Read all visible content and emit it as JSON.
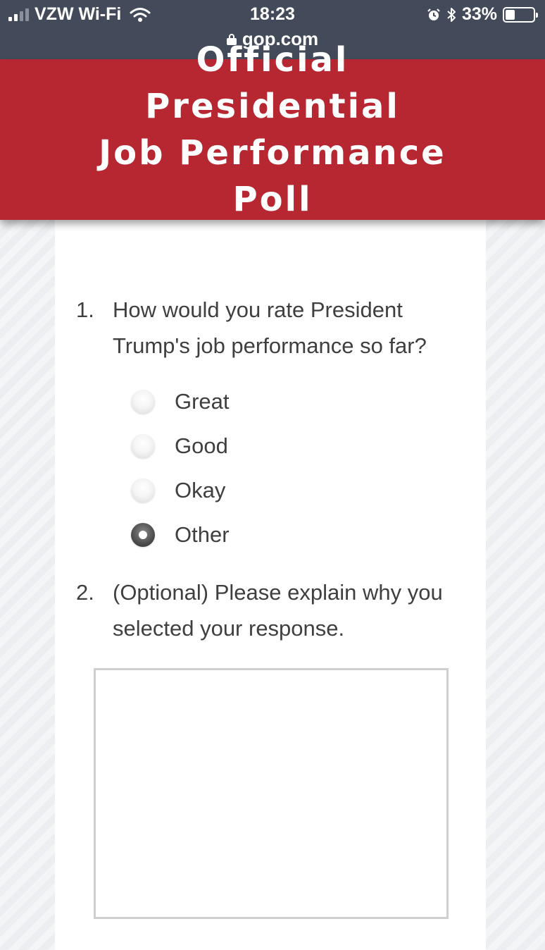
{
  "status_bar": {
    "carrier": "VZW Wi-Fi",
    "time": "18:23",
    "battery": "33%",
    "battery_level": 0.33,
    "url": "gop.com",
    "icons": [
      "signal-icon",
      "wifi-icon",
      "alarm-icon",
      "bluetooth-icon",
      "battery-icon",
      "lock-icon"
    ]
  },
  "banner": {
    "title_line1": "Official Presidential",
    "title_line2": "Job Performance",
    "title_line3": "Poll",
    "color": "#b72732"
  },
  "questions": [
    {
      "number": "1.",
      "text": "How would you rate President Trump's job performance so far?",
      "options": [
        {
          "label": "Great",
          "selected": false
        },
        {
          "label": "Good",
          "selected": false
        },
        {
          "label": "Okay",
          "selected": false
        },
        {
          "label": "Other",
          "selected": true
        }
      ]
    },
    {
      "number": "2.",
      "text": "(Optional) Please explain why you selected your response.",
      "answer_value": ""
    }
  ]
}
